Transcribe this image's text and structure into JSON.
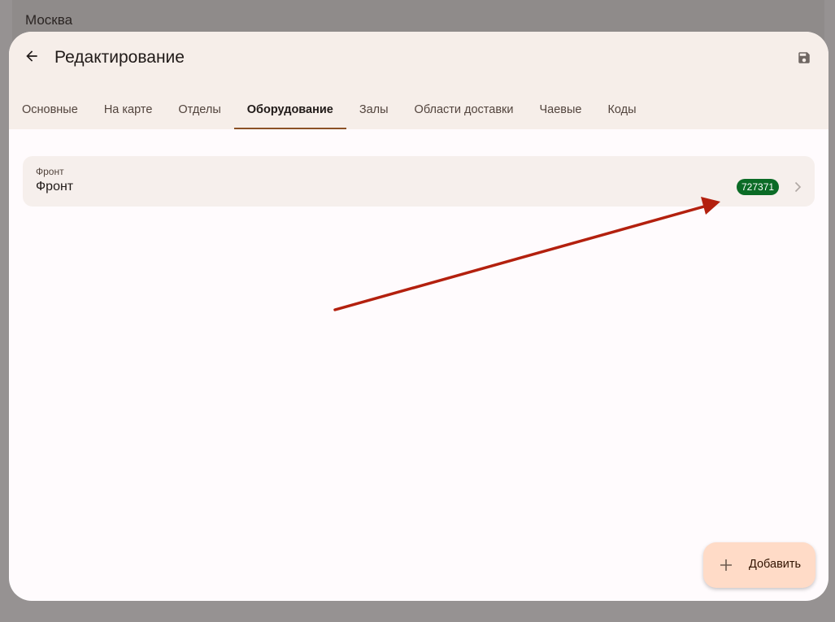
{
  "background": {
    "title": "Москва"
  },
  "header": {
    "title": "Редактирование",
    "back_icon": "arrow-left-icon",
    "save_icon": "save-icon"
  },
  "tabs": [
    {
      "label": "Основные",
      "active": false
    },
    {
      "label": "На карте",
      "active": false
    },
    {
      "label": "Отделы",
      "active": false
    },
    {
      "label": "Оборудование",
      "active": true
    },
    {
      "label": "Залы",
      "active": false
    },
    {
      "label": "Области доставки",
      "active": false
    },
    {
      "label": "Чаевые",
      "active": false
    },
    {
      "label": "Коды",
      "active": false
    }
  ],
  "equipment": {
    "items": [
      {
        "overline": "Фронт",
        "title": "Фронт",
        "badge": "727371"
      }
    ]
  },
  "fab": {
    "label": "Добавить",
    "icon": "plus-icon"
  },
  "colors": {
    "accent": "#8b5025",
    "badge": "#0b6b26",
    "annotation_arrow": "#b3200e",
    "fab": "#ffdbc7"
  }
}
